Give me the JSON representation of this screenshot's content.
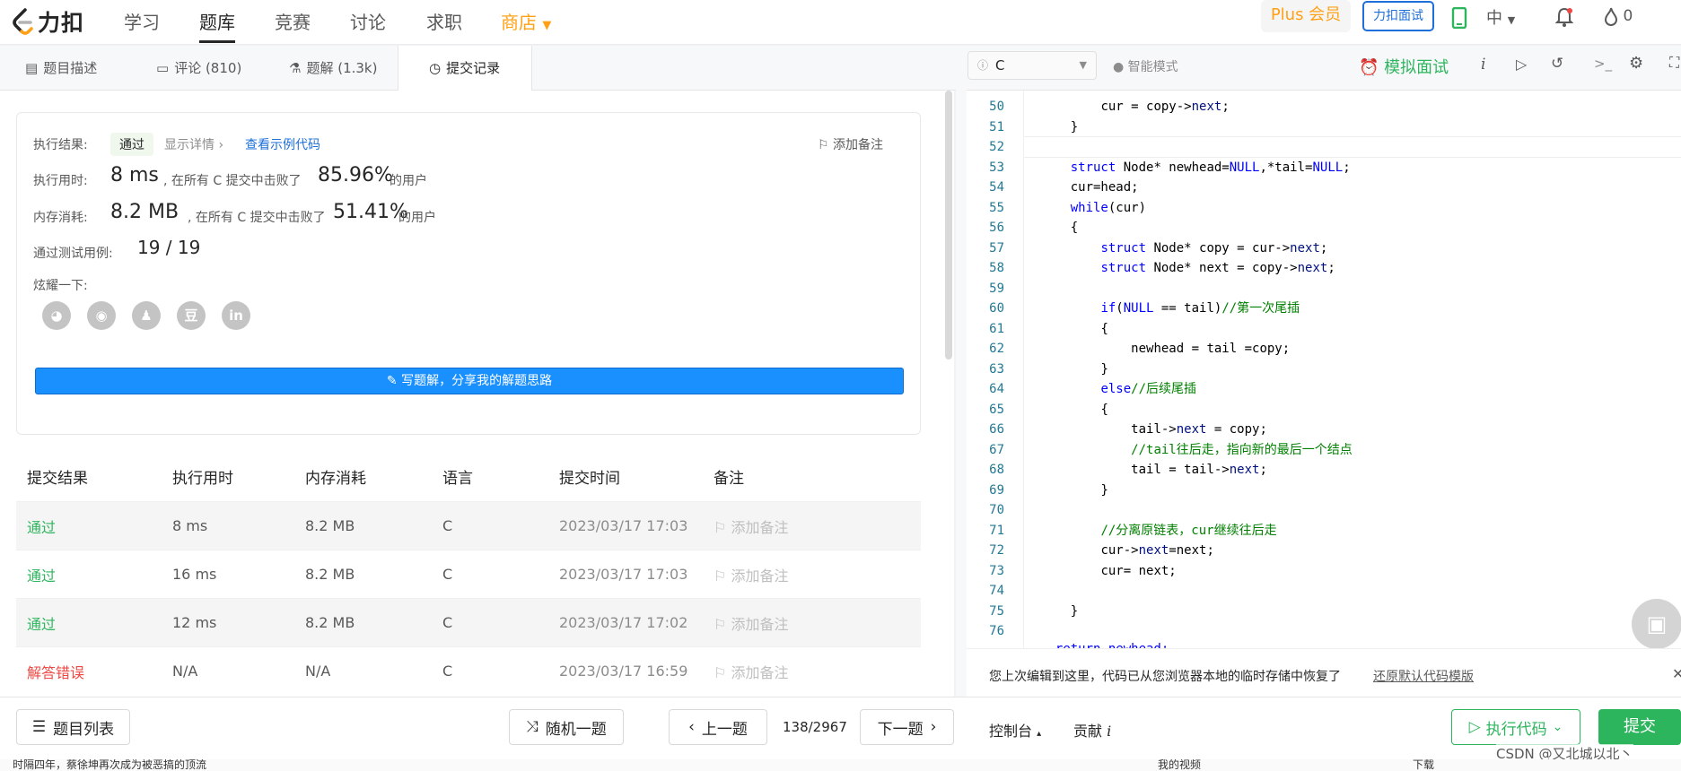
{
  "app": {
    "logo_text": "力扣"
  },
  "nav": {
    "items": [
      "学习",
      "题库",
      "竞赛",
      "讨论",
      "求职"
    ],
    "shop": "商店"
  },
  "header": {
    "plus": "Plus 会员",
    "interview": "力扣面试",
    "lang": "中",
    "points": "0"
  },
  "tabs": [
    {
      "label": "题目描述"
    },
    {
      "label": "评论 (810)"
    },
    {
      "label": "题解 (1.3k)"
    },
    {
      "label": "提交记录"
    }
  ],
  "result": {
    "exec_label": "执行结果:",
    "status": "通过",
    "details": "显示详情 ›",
    "sample": "查看示例代码",
    "add_note": "添加备注",
    "time_label": "执行用时:",
    "time_value": "8 ms",
    "time_text": ", 在所有 C 提交中击败了",
    "time_pct": "85.96%",
    "users": "的用户",
    "mem_label": "内存消耗:",
    "mem_value": "8.2 MB",
    "mem_text": ", 在所有 C 提交中击败了",
    "mem_pct": "51.41%",
    "tests_label": "通过测试用例:",
    "tests_value": "19 / 19",
    "share_label": "炫耀一下:",
    "write_btn": "写题解，分享我的解题思路"
  },
  "table": {
    "headers": [
      "提交结果",
      "执行用时",
      "内存消耗",
      "语言",
      "提交时间",
      "备注"
    ],
    "rows": [
      {
        "result": "通过",
        "time": "8 ms",
        "mem": "8.2 MB",
        "lang": "C",
        "date": "2023/03/17 17:03",
        "note": "添加备注"
      },
      {
        "result": "通过",
        "time": "16 ms",
        "mem": "8.2 MB",
        "lang": "C",
        "date": "2023/03/17 17:03",
        "note": "添加备注"
      },
      {
        "result": "通过",
        "time": "12 ms",
        "mem": "8.2 MB",
        "lang": "C",
        "date": "2023/03/17 17:02",
        "note": "添加备注"
      },
      {
        "result": "解答错误",
        "time": "N/A",
        "mem": "N/A",
        "lang": "C",
        "date": "2023/03/17 16:59",
        "note": "添加备注"
      }
    ]
  },
  "editor": {
    "language": "C",
    "smart_mode": "智能模式",
    "mock_interview": "模拟面试",
    "code_lines": [
      {
        "n": "50",
        "indent": 2,
        "parts": [
          [
            "cur = copy->",
            ""
          ],
          [
            "next",
            "fld"
          ],
          [
            ";",
            ""
          ]
        ]
      },
      {
        "n": "51",
        "indent": 1,
        "parts": [
          [
            "}",
            ""
          ]
        ]
      },
      {
        "n": "52",
        "indent": 0,
        "parts": []
      },
      {
        "n": "53",
        "indent": 1,
        "parts": [
          [
            "struct",
            "kw"
          ],
          [
            " Node* newhead=",
            ""
          ],
          [
            "NULL",
            "kw"
          ],
          [
            ",*tail=",
            ""
          ],
          [
            "NULL",
            "kw"
          ],
          [
            ";",
            ""
          ]
        ]
      },
      {
        "n": "54",
        "indent": 1,
        "parts": [
          [
            "cur=head;",
            ""
          ]
        ]
      },
      {
        "n": "55",
        "indent": 1,
        "parts": [
          [
            "while",
            "kw"
          ],
          [
            "(cur)",
            ""
          ]
        ]
      },
      {
        "n": "56",
        "indent": 1,
        "parts": [
          [
            "{",
            ""
          ]
        ]
      },
      {
        "n": "57",
        "indent": 2,
        "parts": [
          [
            "struct",
            "kw"
          ],
          [
            " Node* copy = cur->",
            ""
          ],
          [
            "next",
            "fld"
          ],
          [
            ";",
            ""
          ]
        ]
      },
      {
        "n": "58",
        "indent": 2,
        "parts": [
          [
            "struct",
            "kw"
          ],
          [
            " Node* next = copy->",
            ""
          ],
          [
            "next",
            "fld"
          ],
          [
            ";",
            ""
          ]
        ]
      },
      {
        "n": "59",
        "indent": 0,
        "parts": []
      },
      {
        "n": "60",
        "indent": 2,
        "parts": [
          [
            "if",
            "kw"
          ],
          [
            "(",
            ""
          ],
          [
            "NULL",
            "kw"
          ],
          [
            " == tail)",
            ""
          ],
          [
            "//第一次尾插",
            "cm"
          ]
        ]
      },
      {
        "n": "61",
        "indent": 2,
        "parts": [
          [
            "{",
            ""
          ]
        ]
      },
      {
        "n": "62",
        "indent": 3,
        "parts": [
          [
            "newhead = tail =copy;",
            ""
          ]
        ]
      },
      {
        "n": "63",
        "indent": 2,
        "parts": [
          [
            "}",
            ""
          ]
        ]
      },
      {
        "n": "64",
        "indent": 2,
        "parts": [
          [
            "else",
            "kw"
          ],
          [
            "//后续尾插",
            "cm"
          ]
        ]
      },
      {
        "n": "65",
        "indent": 2,
        "parts": [
          [
            "{",
            ""
          ]
        ]
      },
      {
        "n": "66",
        "indent": 3,
        "parts": [
          [
            "tail->",
            ""
          ],
          [
            "next",
            "fld"
          ],
          [
            " = copy;",
            ""
          ]
        ]
      },
      {
        "n": "67",
        "indent": 3,
        "parts": [
          [
            "//tail往后走，指向新的最后一个结点",
            "cm"
          ]
        ]
      },
      {
        "n": "68",
        "indent": 3,
        "parts": [
          [
            "tail = tail->",
            ""
          ],
          [
            "next",
            "fld"
          ],
          [
            ";",
            ""
          ]
        ]
      },
      {
        "n": "69",
        "indent": 2,
        "parts": [
          [
            "}",
            ""
          ]
        ]
      },
      {
        "n": "70",
        "indent": 0,
        "parts": []
      },
      {
        "n": "71",
        "indent": 2,
        "parts": [
          [
            "//分离原链表，cur继续往后走",
            "cm"
          ]
        ]
      },
      {
        "n": "72",
        "indent": 2,
        "parts": [
          [
            "cur->",
            ""
          ],
          [
            "next",
            "fld"
          ],
          [
            "=next;",
            ""
          ]
        ]
      },
      {
        "n": "73",
        "indent": 2,
        "parts": [
          [
            "cur= next;",
            ""
          ]
        ]
      },
      {
        "n": "74",
        "indent": 0,
        "parts": []
      },
      {
        "n": "75",
        "indent": 1,
        "parts": [
          [
            "}",
            ""
          ]
        ]
      },
      {
        "n": "76",
        "indent": 0,
        "parts": []
      }
    ],
    "restore_msg": "您上次编辑到这里，代码已从您浏览器本地的临时存储中恢复了",
    "restore_link": "还原默认代码模版"
  },
  "bottom": {
    "list": "题目列表",
    "random": "随机一题",
    "prev": "上一题",
    "progress": "138/2967",
    "next": "下一题",
    "console": "控制台",
    "contribute": "贡献",
    "run": "执行代码",
    "submit": "提交"
  },
  "footer": {
    "text": "时隔四年，蔡徐坤再次成为被恶搞的顶流",
    "watermark": "CSDN @又北城以北丶",
    "video": "我的视频",
    "download": "下载"
  }
}
